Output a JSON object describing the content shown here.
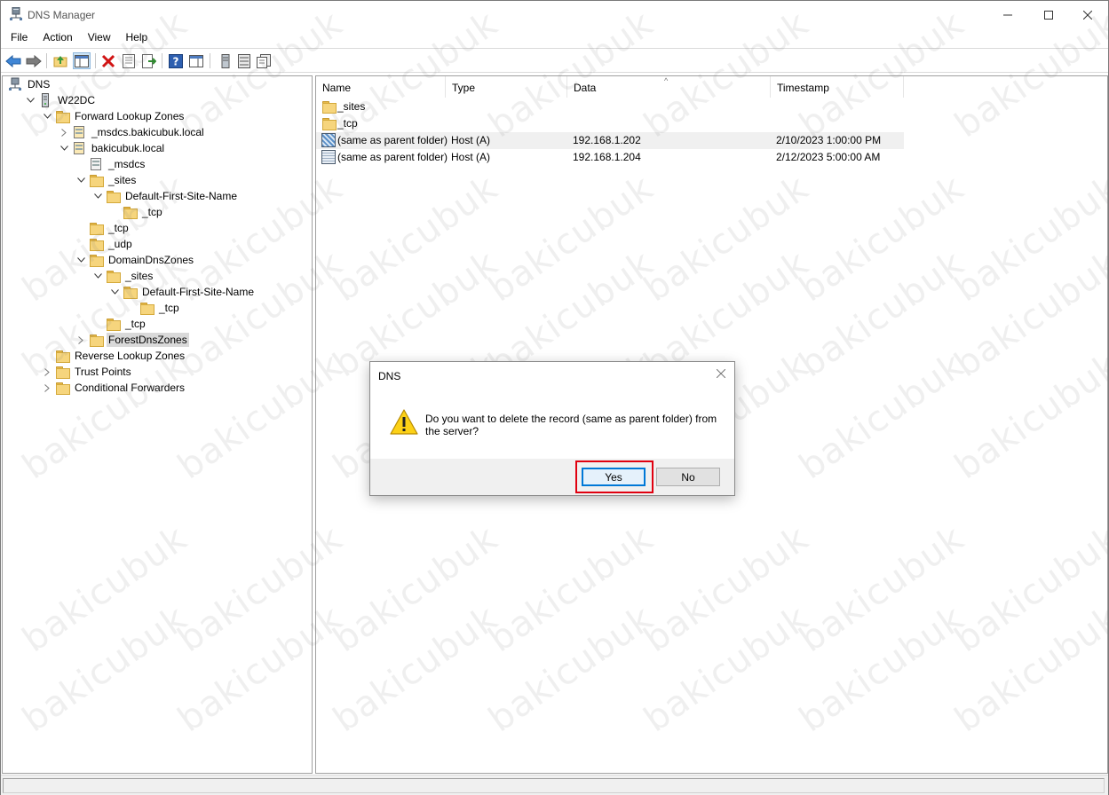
{
  "window": {
    "title": "DNS Manager"
  },
  "menu": [
    "File",
    "Action",
    "View",
    "Help"
  ],
  "tree": [
    {
      "label": "DNS",
      "depth": 0,
      "icon": "dns-icon",
      "expand": "none",
      "selected": false
    },
    {
      "label": "W22DC",
      "depth": 1,
      "icon": "server-icon",
      "expand": "expanded",
      "selected": false
    },
    {
      "label": "Forward Lookup Zones",
      "depth": 2,
      "icon": "folder-icon",
      "expand": "expanded",
      "selected": false
    },
    {
      "label": "_msdcs.bakicubuk.local",
      "depth": 3,
      "icon": "zone-icon",
      "expand": "collapsed",
      "selected": false
    },
    {
      "label": "bakicubuk.local",
      "depth": 3,
      "icon": "zone-icon",
      "expand": "expanded",
      "selected": false
    },
    {
      "label": "_msdcs",
      "depth": 4,
      "icon": "delegated-zone-icon",
      "expand": "none",
      "selected": false
    },
    {
      "label": "_sites",
      "depth": 4,
      "icon": "folder-icon",
      "expand": "expanded",
      "selected": false
    },
    {
      "label": "Default-First-Site-Name",
      "depth": 5,
      "icon": "folder-icon",
      "expand": "expanded",
      "selected": false
    },
    {
      "label": "_tcp",
      "depth": 6,
      "icon": "folder-icon",
      "expand": "none",
      "selected": false
    },
    {
      "label": "_tcp",
      "depth": 4,
      "icon": "folder-icon",
      "expand": "none",
      "selected": false
    },
    {
      "label": "_udp",
      "depth": 4,
      "icon": "folder-icon",
      "expand": "none",
      "selected": false
    },
    {
      "label": "DomainDnsZones",
      "depth": 4,
      "icon": "folder-icon",
      "expand": "expanded",
      "selected": false
    },
    {
      "label": "_sites",
      "depth": 5,
      "icon": "folder-icon",
      "expand": "expanded",
      "selected": false
    },
    {
      "label": "Default-First-Site-Name",
      "depth": 6,
      "icon": "folder-icon",
      "expand": "expanded",
      "selected": false
    },
    {
      "label": "_tcp",
      "depth": 7,
      "icon": "folder-icon",
      "expand": "none",
      "selected": false
    },
    {
      "label": "_tcp",
      "depth": 5,
      "icon": "folder-icon",
      "expand": "none",
      "selected": false
    },
    {
      "label": "ForestDnsZones",
      "depth": 4,
      "icon": "folder-icon",
      "expand": "collapsed",
      "selected": true
    },
    {
      "label": "Reverse Lookup Zones",
      "depth": 2,
      "icon": "folder-icon",
      "expand": "none",
      "selected": false
    },
    {
      "label": "Trust Points",
      "depth": 2,
      "icon": "folder-icon",
      "expand": "collapsed",
      "selected": false
    },
    {
      "label": "Conditional Forwarders",
      "depth": 2,
      "icon": "folder-icon",
      "expand": "collapsed",
      "selected": false
    }
  ],
  "list": {
    "columns": [
      "Name",
      "Type",
      "Data",
      "Timestamp"
    ],
    "rows": [
      {
        "name": "_sites",
        "type": "",
        "data": "",
        "timestamp": "",
        "icon": "folder-icon",
        "highlighted": false
      },
      {
        "name": "_tcp",
        "type": "",
        "data": "",
        "timestamp": "",
        "icon": "folder-icon",
        "highlighted": false
      },
      {
        "name": "(same as parent folder)",
        "type": "Host (A)",
        "data": "192.168.1.202",
        "timestamp": "2/10/2023 1:00:00 PM",
        "icon": "host-record-icon",
        "highlighted": true
      },
      {
        "name": "(same as parent folder)",
        "type": "Host (A)",
        "data": "192.168.1.204",
        "timestamp": "2/12/2023 5:00:00 AM",
        "icon": "host-record-icon",
        "highlighted": false
      }
    ]
  },
  "dialog": {
    "title": "DNS",
    "message": "Do you want to delete the record (same as parent folder) from the server?",
    "yes_label": "Yes",
    "no_label": "No"
  },
  "watermark": "bakicubuk",
  "colors": {
    "accent": "#0078d7",
    "highlight_box": "#e0000f",
    "selection": "#d9d9d9"
  }
}
